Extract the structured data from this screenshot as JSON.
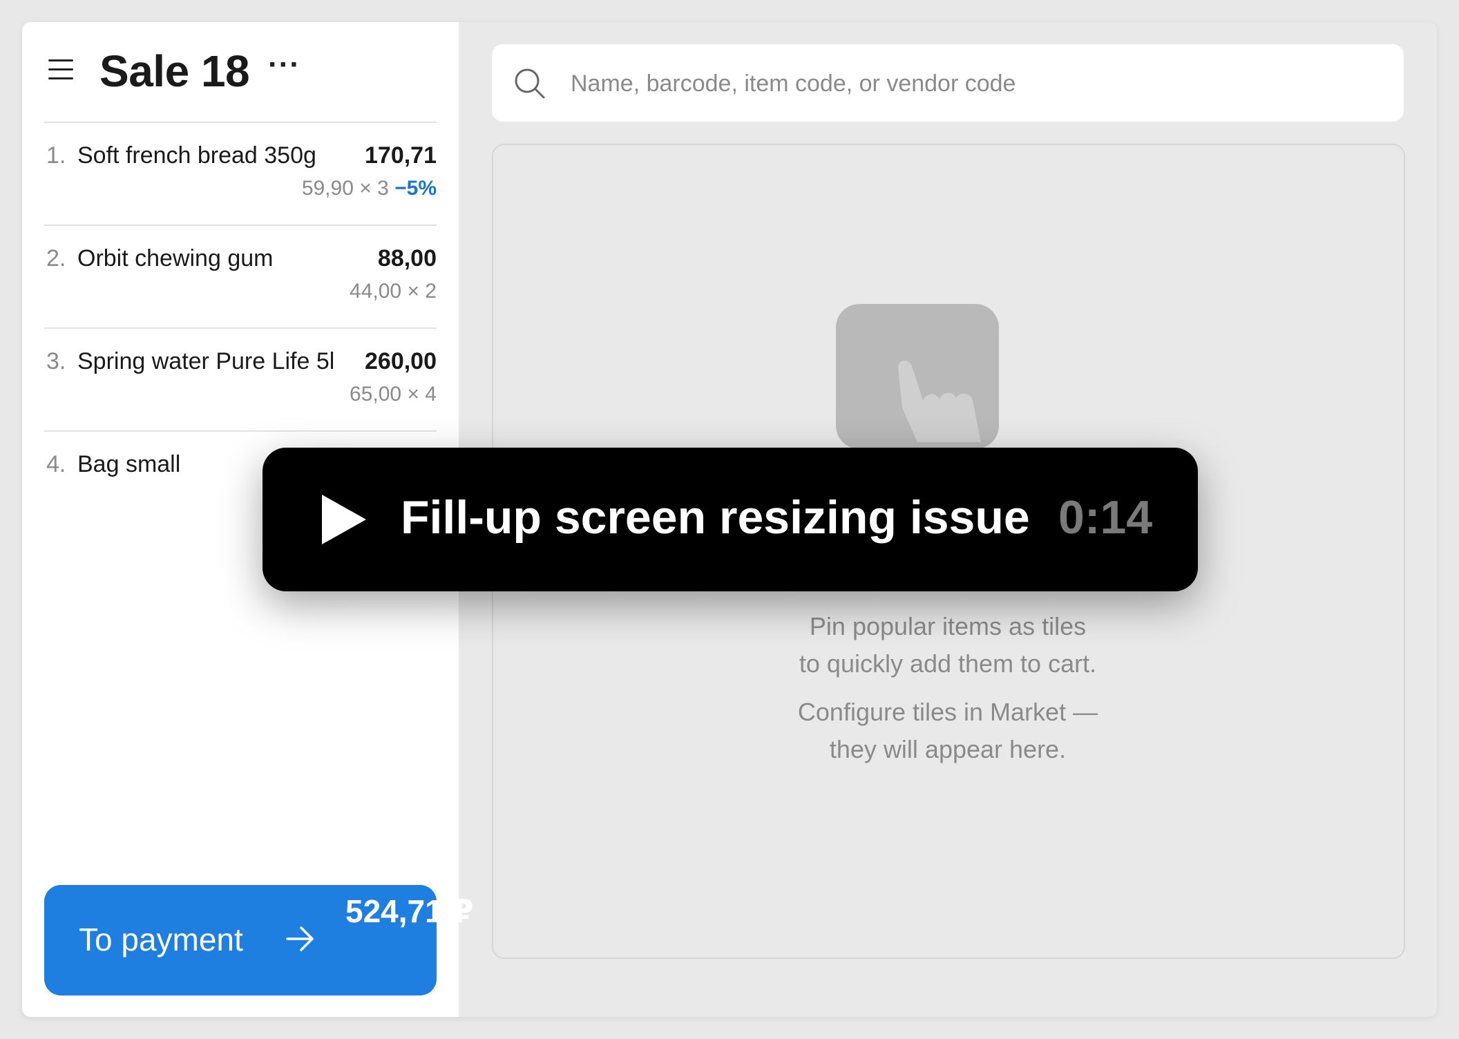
{
  "sale": {
    "title": "Sale 18",
    "more_label": "···"
  },
  "cart": {
    "items": [
      {
        "num": "1.",
        "name": "Soft french bread 350g",
        "total": "170,71",
        "detail": "59,90 × 3",
        "discount": "−5%"
      },
      {
        "num": "2.",
        "name": "Orbit chewing gum",
        "total": "88,00",
        "detail": "44,00 × 2",
        "discount": ""
      },
      {
        "num": "3.",
        "name": "Spring water Pure Life 5l",
        "total": "260,00",
        "detail": "65,00 × 4",
        "discount": ""
      },
      {
        "num": "4.",
        "name": "Bag small",
        "total": "",
        "detail": "",
        "discount": ""
      }
    ]
  },
  "payment": {
    "label": "To payment",
    "total": "524,71 ₽"
  },
  "search": {
    "placeholder": "Name, barcode, item code, or vendor code"
  },
  "tiles": {
    "line1": "Pin popular items as tiles",
    "line2": "to quickly add them to cart.",
    "line3": "Configure tiles in Market —",
    "line4": "they will appear here."
  },
  "video": {
    "title": "Fill-up screen resizing issue",
    "duration": "0:14"
  },
  "colors": {
    "accent": "#1e7fe0",
    "discount": "#1a73d0",
    "overlay": "#000000"
  },
  "icons": [
    "hamburger-icon",
    "more-icon",
    "search-icon",
    "arrow-right-icon",
    "tile-pointer-icon",
    "play-icon"
  ]
}
